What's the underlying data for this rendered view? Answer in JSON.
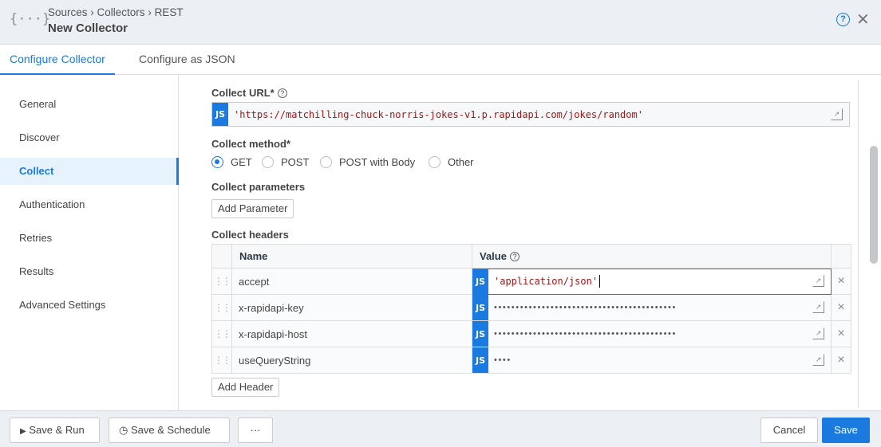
{
  "header": {
    "breadcrumb": [
      "Sources",
      "Collectors",
      "REST"
    ],
    "title": "New Collector",
    "logo": "{···}"
  },
  "tabs": [
    {
      "label": "Configure Collector",
      "active": true
    },
    {
      "label": "Configure as JSON"
    }
  ],
  "sidebar": {
    "items": [
      {
        "label": "General"
      },
      {
        "label": "Discover"
      },
      {
        "label": "Collect",
        "active": true
      },
      {
        "label": "Authentication"
      },
      {
        "label": "Retries"
      },
      {
        "label": "Results"
      },
      {
        "label": "Advanced Settings"
      }
    ]
  },
  "collect": {
    "url_label": "Collect URL*",
    "url_value": "'https://matchilling-chuck-norris-jokes-v1.p.rapidapi.com/jokes/random'",
    "method_label": "Collect method*",
    "methods": [
      {
        "label": "GET",
        "selected": true
      },
      {
        "label": "POST"
      },
      {
        "label": "POST with Body"
      },
      {
        "label": "Other"
      }
    ],
    "params_label": "Collect parameters",
    "add_param": "Add Parameter",
    "headers_label": "Collect headers",
    "columns": {
      "name": "Name",
      "value": "Value"
    },
    "headers": [
      {
        "name": "accept",
        "value": "'application/json'"
      },
      {
        "name": "x-rapidapi-key",
        "value": "••••••••••••••••••••••••••••••••••••••••••"
      },
      {
        "name": "x-rapidapi-host",
        "value": "••••••••••••••••••••••••••••••••••••••••••"
      },
      {
        "name": "useQueryString",
        "value": "••••"
      }
    ],
    "add_header": "Add Header",
    "js_badge": "JS"
  },
  "footer": {
    "save_run": "Save & Run",
    "save_schedule": "Save & Schedule",
    "more": "···",
    "cancel": "Cancel",
    "save": "Save"
  },
  "colors": {
    "accent": "#1a7ae0"
  }
}
